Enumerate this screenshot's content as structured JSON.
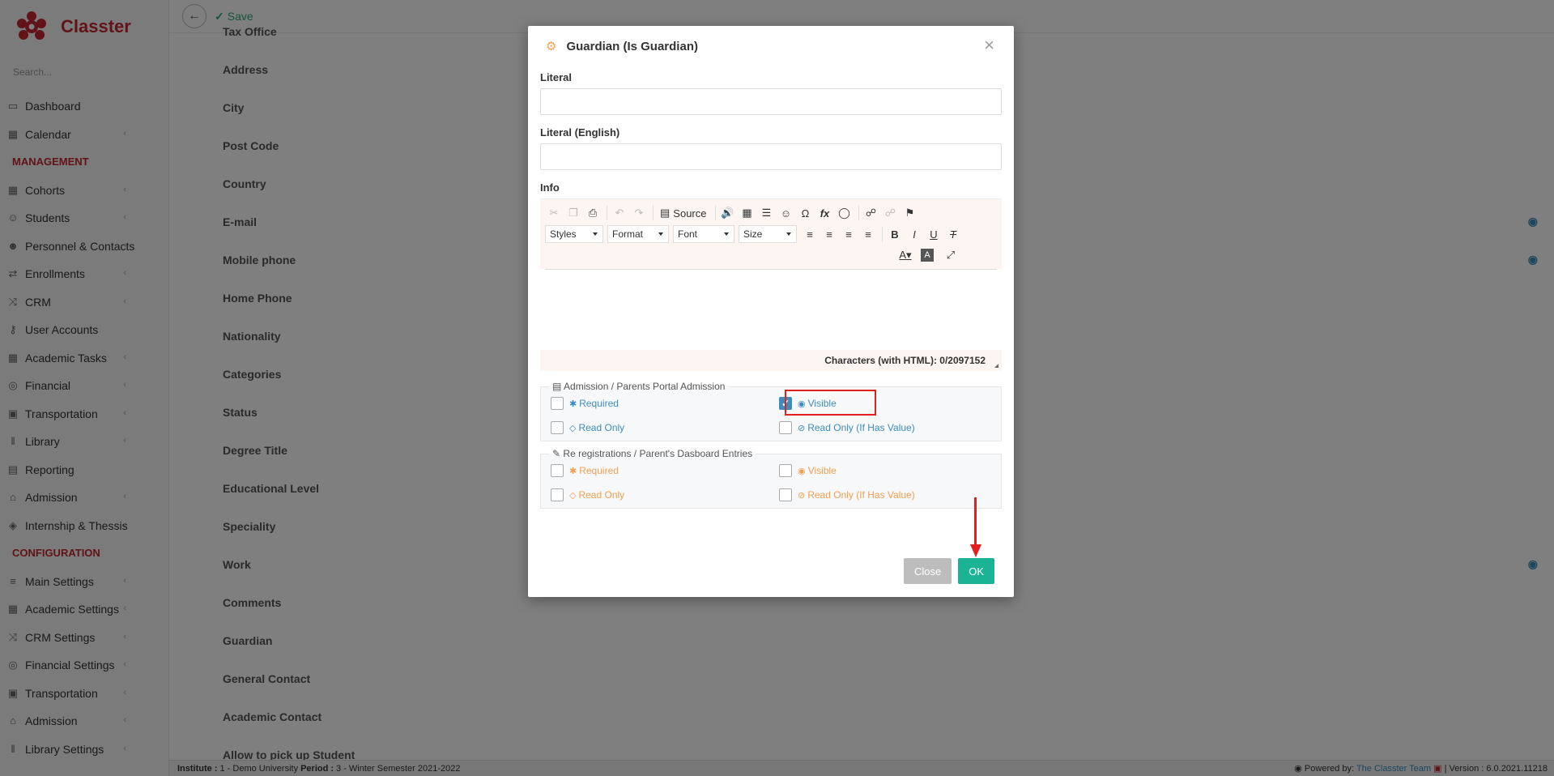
{
  "app": {
    "name": "Classter",
    "search_placeholder": "Search..."
  },
  "sidebar": {
    "top_items": [
      {
        "label": "Dashboard",
        "icon": "laptop-icon"
      },
      {
        "label": "Calendar",
        "icon": "calendar-icon"
      }
    ],
    "management_title": "MANAGEMENT",
    "management_items": [
      {
        "label": "Cohorts",
        "icon": "grid-icon"
      },
      {
        "label": "Students",
        "icon": "users-icon"
      },
      {
        "label": "Personnel & Contacts",
        "icon": "user-tie-icon"
      },
      {
        "label": "Enrollments",
        "icon": "exchange-icon"
      },
      {
        "label": "CRM",
        "icon": "random-icon"
      },
      {
        "label": "User Accounts",
        "icon": "key-icon"
      },
      {
        "label": "Academic Tasks",
        "icon": "th-icon"
      },
      {
        "label": "Financial",
        "icon": "coins-icon"
      },
      {
        "label": "Transportation",
        "icon": "bus-icon"
      },
      {
        "label": "Library",
        "icon": "books-icon"
      },
      {
        "label": "Reporting",
        "icon": "print-icon"
      },
      {
        "label": "Admission",
        "icon": "university-icon"
      },
      {
        "label": "Internship & Thessis",
        "icon": "cube-icon"
      }
    ],
    "configuration_title": "CONFIGURATION",
    "configuration_items": [
      {
        "label": "Main Settings",
        "icon": "sliders-icon"
      },
      {
        "label": "Academic Settings",
        "icon": "grid-icon"
      },
      {
        "label": "CRM Settings",
        "icon": "random-icon"
      },
      {
        "label": "Financial Settings",
        "icon": "coins-icon"
      },
      {
        "label": "Transportation",
        "icon": "bus-icon"
      },
      {
        "label": "Admission",
        "icon": "university-icon"
      },
      {
        "label": "Library Settings",
        "icon": "books-icon"
      }
    ]
  },
  "toolbar": {
    "save_label": "Save"
  },
  "fields": [
    {
      "label": "Tax Office",
      "visible": false
    },
    {
      "label": "Address",
      "visible": false
    },
    {
      "label": "City",
      "visible": false
    },
    {
      "label": "Post Code",
      "visible": false
    },
    {
      "label": "Country",
      "visible": false
    },
    {
      "label": "E-mail",
      "visible": true
    },
    {
      "label": "Mobile phone",
      "visible": true
    },
    {
      "label": "Home Phone",
      "visible": false
    },
    {
      "label": "Nationality",
      "visible": false
    },
    {
      "label": "Categories",
      "visible": false
    },
    {
      "label": "Status",
      "visible": false
    },
    {
      "label": "Degree Title",
      "visible": false
    },
    {
      "label": "Educational Level",
      "visible": false
    },
    {
      "label": "Speciality",
      "visible": false
    },
    {
      "label": "Work",
      "visible": true
    },
    {
      "label": "Comments",
      "visible": false
    },
    {
      "label": "Guardian",
      "visible": false
    },
    {
      "label": "General Contact",
      "visible": false
    },
    {
      "label": "Academic Contact",
      "visible": false
    },
    {
      "label": "Allow to pick up Student",
      "visible": false
    }
  ],
  "statusbar": {
    "institute_label": "Institute :",
    "institute_value": "1 - Demo University",
    "period_label": "Period :",
    "period_value": "3 - Winter Semester 2021-2022",
    "powered_by": "Powered by:",
    "powered_link": "The Classter Team",
    "version": "| Version : 6.0.2021.11218"
  },
  "modal": {
    "title": "Guardian (Is Guardian)",
    "literal_label": "Literal",
    "literal_value": "",
    "literal_en_label": "Literal (English)",
    "literal_en_value": "",
    "info_label": "Info",
    "editor": {
      "source_label": "Source",
      "styles": "Styles",
      "format": "Format",
      "font": "Font",
      "size": "Size",
      "char_count": "Characters (with HTML): 0/2097152"
    },
    "group1": {
      "legend": "Admission / Parents Portal Admission",
      "required": "Required",
      "visible": "Visible",
      "read_only": "Read Only",
      "read_only_if": "Read Only (If Has Value)",
      "required_checked": false,
      "visible_checked": true,
      "read_only_checked": false,
      "read_only_if_checked": false
    },
    "group2": {
      "legend": "Re registrations / Parent's Dasboard Entries",
      "required": "Required",
      "visible": "Visible",
      "read_only": "Read Only",
      "read_only_if": "Read Only (If Has Value)"
    },
    "close_label": "Close",
    "ok_label": "OK"
  },
  "colors": {
    "brand": "#c4262e",
    "accent_blue": "#3c8dbc",
    "accent_orange": "#f0a050",
    "ok_green": "#1ab394",
    "highlight_red": "#e32020"
  }
}
